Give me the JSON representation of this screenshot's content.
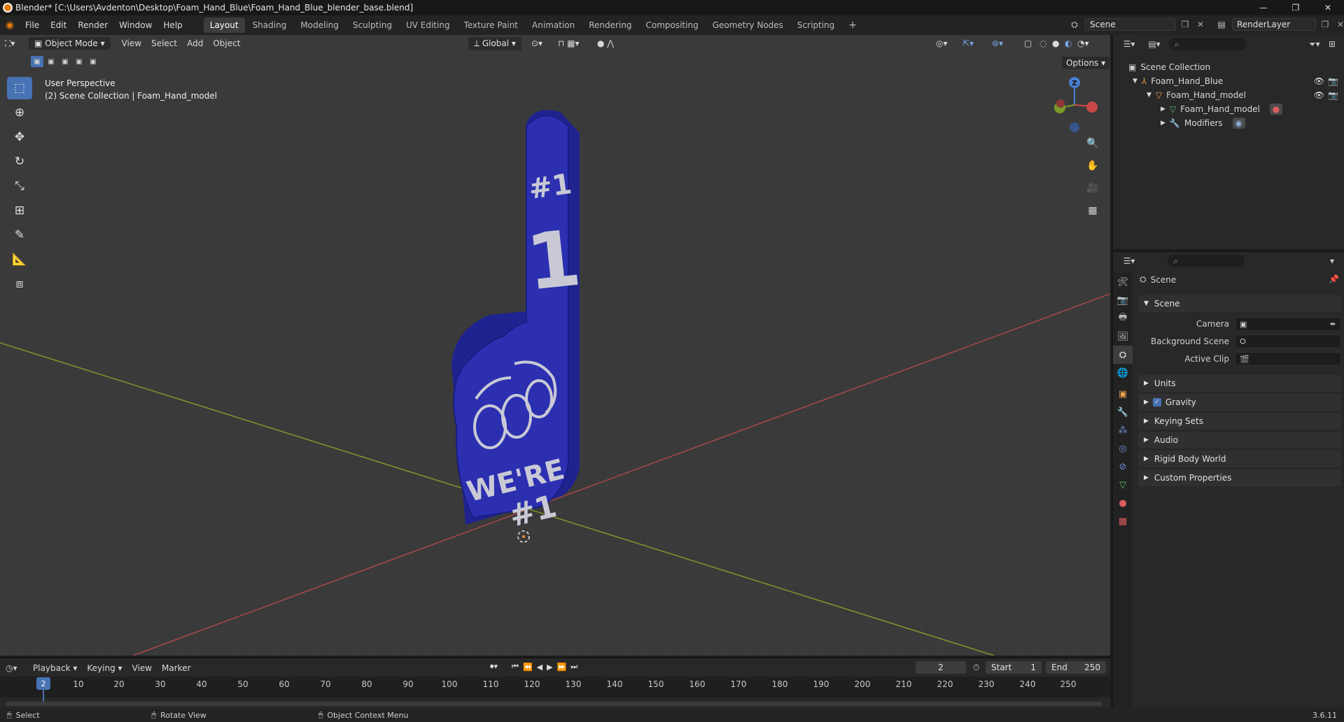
{
  "window": {
    "title": "Blender* [C:\\Users\\Avdenton\\Desktop\\Foam_Hand_Blue\\Foam_Hand_Blue_blender_base.blend]",
    "minimize": "—",
    "maximize": "❐",
    "close": "✕"
  },
  "menu": [
    "File",
    "Edit",
    "Render",
    "Window",
    "Help"
  ],
  "workspaces": [
    "Layout",
    "Shading",
    "Modeling",
    "Sculpting",
    "UV Editing",
    "Texture Paint",
    "Animation",
    "Rendering",
    "Compositing",
    "Geometry Nodes",
    "Scripting"
  ],
  "workspace_add": "+",
  "scene_field": "Scene",
  "view_layer_field": "RenderLayer",
  "viewport": {
    "mode": "Object Mode",
    "menus": [
      "View",
      "Select",
      "Add",
      "Object"
    ],
    "transform_orientation": "Global",
    "options": "Options",
    "perspective": "User Perspective",
    "collection": "(2) Scene Collection | Foam_Hand_model",
    "gizmo_axis": "Z"
  },
  "model_text": {
    "number": "#1",
    "slogan_1": "WE'RE",
    "slogan_2": "#1"
  },
  "outliner": {
    "root": "Scene Collection",
    "items": [
      {
        "label": "Foam_Hand_Blue"
      },
      {
        "label": "Foam_Hand_model"
      },
      {
        "label": "Foam_Hand_model"
      },
      {
        "label": "Modifiers"
      }
    ]
  },
  "properties": {
    "header": "Scene",
    "panel_scene": "Scene",
    "camera_label": "Camera",
    "background_label": "Background Scene",
    "clip_label": "Active Clip",
    "panels": [
      "Units",
      "Gravity",
      "Keying Sets",
      "Audio",
      "Rigid Body World",
      "Custom Properties"
    ]
  },
  "timeline": {
    "menus": [
      "Playback",
      "Keying",
      "View",
      "Marker"
    ],
    "current_frame": "2",
    "start_label": "Start",
    "start_value": "1",
    "end_label": "End",
    "end_value": "250",
    "ticks": [
      "10",
      "20",
      "30",
      "40",
      "50",
      "60",
      "70",
      "80",
      "90",
      "100",
      "110",
      "120",
      "130",
      "140",
      "150",
      "160",
      "170",
      "180",
      "190",
      "200",
      "210",
      "220",
      "230",
      "240",
      "250"
    ]
  },
  "status": {
    "select": "Select",
    "rotate": "Rotate View",
    "context": "Object Context Menu",
    "version": "3.6.11"
  },
  "colors": {
    "accent": "#4772b3",
    "model_blue": "#2b2fb0",
    "x_axis": "#b34b4b",
    "y_axis": "#7a9a2a"
  }
}
